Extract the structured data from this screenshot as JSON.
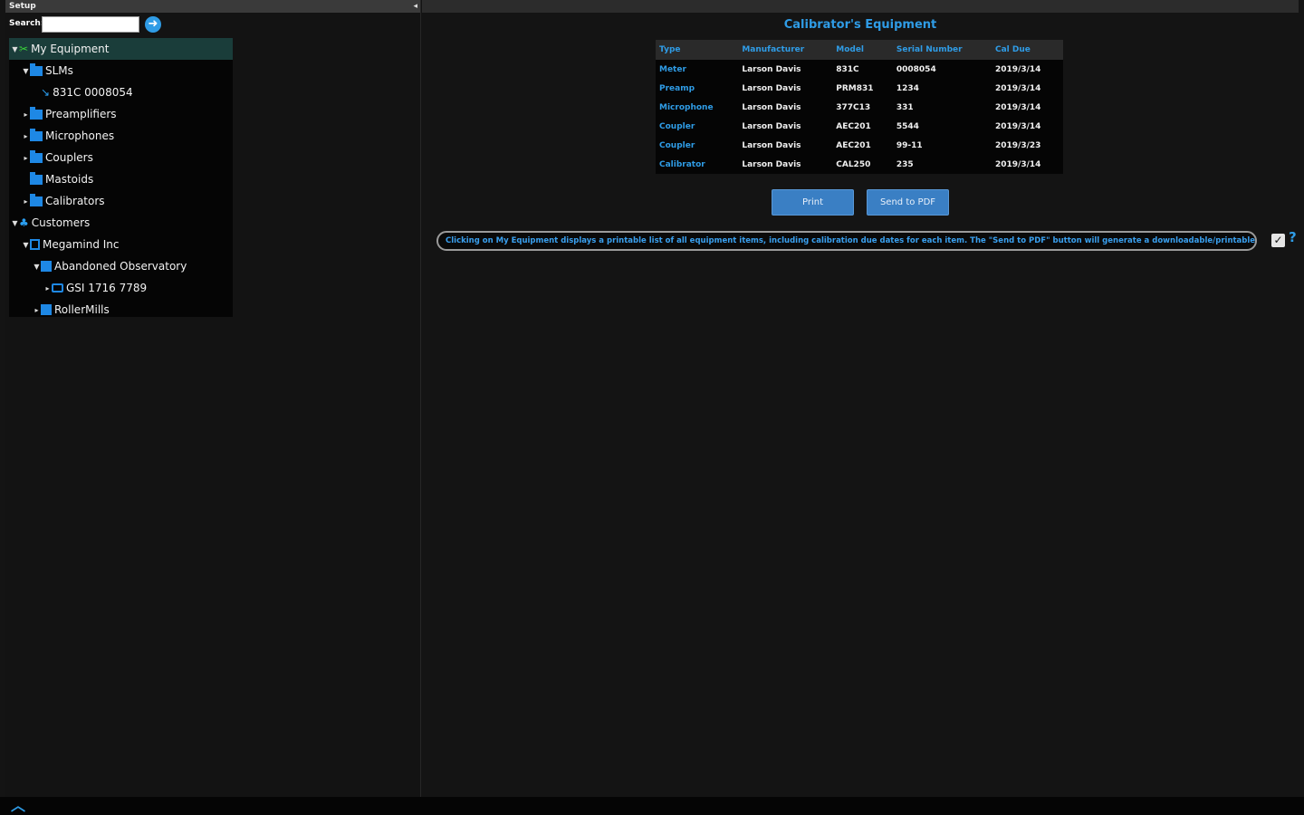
{
  "panel": {
    "title": "Setup"
  },
  "search": {
    "label": "Search:",
    "value": "",
    "placeholder": ""
  },
  "tree": {
    "items": [
      {
        "label": "My Equipment"
      },
      {
        "label": "SLMs"
      },
      {
        "label": "831C 0008054"
      },
      {
        "label": "Preamplifiers"
      },
      {
        "label": "Microphones"
      },
      {
        "label": "Couplers"
      },
      {
        "label": "Mastoids"
      },
      {
        "label": "Calibrators"
      },
      {
        "label": "Customers"
      },
      {
        "label": "Megamind Inc"
      },
      {
        "label": "Abandoned Observatory"
      },
      {
        "label": "GSI 1716 7789"
      },
      {
        "label": "RollerMills"
      }
    ]
  },
  "equipment": {
    "title": "Calibrator's Equipment",
    "columns": [
      "Type",
      "Manufacturer",
      "Model",
      "Serial Number",
      "Cal Due"
    ],
    "rows": [
      [
        "Meter",
        "Larson Davis",
        "831C",
        "0008054",
        "2019/3/14"
      ],
      [
        "Preamp",
        "Larson Davis",
        "PRM831",
        "1234",
        "2019/3/14"
      ],
      [
        "Microphone",
        "Larson Davis",
        "377C13",
        "331",
        "2019/3/14"
      ],
      [
        "Coupler",
        "Larson Davis",
        "AEC201",
        "5544",
        "2019/3/14"
      ],
      [
        "Coupler",
        "Larson Davis",
        "AEC201",
        "99-11",
        "2019/3/23"
      ],
      [
        "Calibrator",
        "Larson Davis",
        "CAL250",
        "235",
        "2019/3/14"
      ]
    ]
  },
  "buttons": {
    "print": "Print",
    "send_pdf": "Send to PDF"
  },
  "help": {
    "text": "Clicking on My Equipment displays a printable list of all equipment items, including calibration due dates for each item. The \"Send to PDF\" button will generate a downloadable/printable PDF equipment listing.",
    "question": "?",
    "checkbox": "✓"
  },
  "colors": {
    "accent": "#2f9ce6",
    "selected_row": "#1a3d3a",
    "folder": "#1e88e5"
  }
}
